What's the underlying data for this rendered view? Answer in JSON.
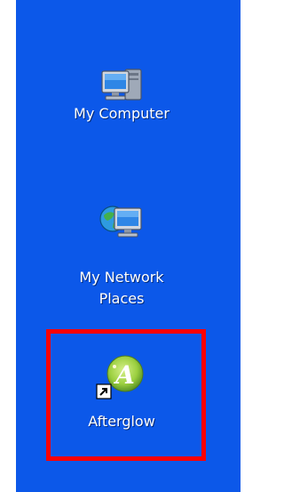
{
  "desktop": {
    "background_color": "#0C58E9",
    "icons": [
      {
        "label": "My Computer",
        "icon": "computer-icon"
      },
      {
        "label": "My Network\nPlaces",
        "icon": "network-places-icon"
      },
      {
        "label": "Afterglow",
        "icon": "afterglow-app-icon",
        "shortcut": true
      }
    ],
    "highlight_color": "#ff0000"
  }
}
